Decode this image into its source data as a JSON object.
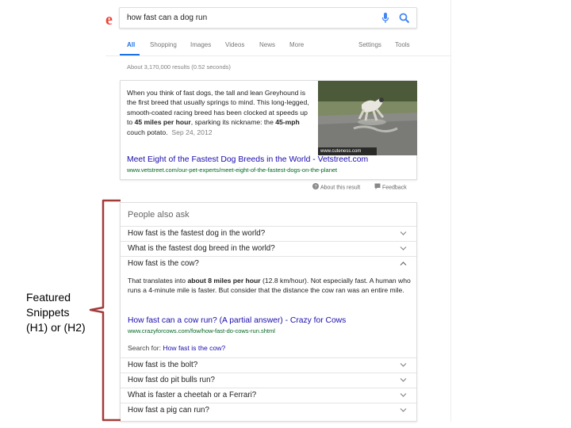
{
  "google": {
    "logo_fragment": "e",
    "search": {
      "query": "how fast can a dog run"
    },
    "tabs": [
      "All",
      "Shopping",
      "Images",
      "Videos",
      "News",
      "More"
    ],
    "tools": [
      "Settings",
      "Tools"
    ],
    "result_stats": "About 3,170,000 results (0.52 seconds)"
  },
  "featured_snippet": {
    "desc_1": "When you think of fast dogs, the tall and lean Greyhound is the first breed that usually springs to mind. This long-legged, smooth-coated racing breed has been clocked at speeds up to ",
    "desc_bold_1": "45 miles per hour",
    "desc_2": ", sparking its nickname: the ",
    "desc_bold_2": "45-mph",
    "desc_3": " couch potato.",
    "date": "Sep 24, 2012",
    "image_credit": "www.cuteness.com",
    "title": "Meet Eight of the Fastest Dog Breeds in the World - Vetstreet.com",
    "url": "www.vetstreet.com/our-pet-experts/meet-eight-of-the-fastest-dogs-on-the-planet",
    "about_label": "About this result",
    "feedback_label": "Feedback"
  },
  "people_also_ask": {
    "title": "People also ask",
    "questions_top": [
      "How fast is the fastest dog in the world?",
      "What is the fastest dog breed in the world?",
      "How fast is the cow?"
    ],
    "answer": {
      "text_1": "That translates into ",
      "text_bold": "about 8 miles per hour",
      "text_2": " (12.8 km/hour). Not especially fast. A human who runs a 4-minute mile is faster. But consider that the distance the cow ran was an entire mile.",
      "title": "How fast can a cow run? (A partial answer) - Crazy for Cows",
      "url": "www.crazyforcows.com/fow/how-fast-do-cows-run.shtml",
      "search_for_label": "Search for:",
      "search_for_link": "How fast is the cow?"
    },
    "questions_bottom": [
      "How fast is the bolt?",
      "How fast do pit bulls run?",
      "What is faster a cheetah or a Ferrari?",
      "How fast a pig can run?"
    ]
  },
  "annotation": {
    "lines": [
      "Featured",
      "Snippets",
      "(H1) or (H2)"
    ],
    "bracket_color": "#a33b3b"
  },
  "colors": {
    "link": "#1a0dab",
    "url": "#006621",
    "accent": "#1a73e8"
  }
}
